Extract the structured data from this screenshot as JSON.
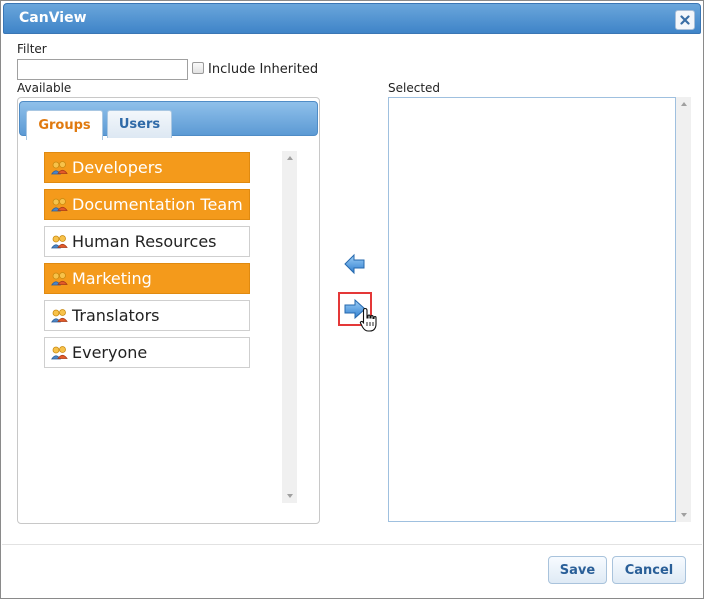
{
  "dialog": {
    "title": "CanView"
  },
  "filter": {
    "label": "Filter",
    "value": "",
    "include_inherited_label": "Include Inherited",
    "include_inherited_checked": false
  },
  "available": {
    "label": "Available",
    "tabs": [
      {
        "label": "Groups",
        "active": true
      },
      {
        "label": "Users",
        "active": false
      }
    ],
    "items": [
      {
        "label": "Developers",
        "selected": true
      },
      {
        "label": "Documentation Team",
        "selected": true
      },
      {
        "label": "Human Resources",
        "selected": false
      },
      {
        "label": "Marketing",
        "selected": true
      },
      {
        "label": "Translators",
        "selected": false
      },
      {
        "label": "Everyone",
        "selected": false
      }
    ]
  },
  "selected": {
    "label": "Selected"
  },
  "buttons": {
    "save": "Save",
    "cancel": "Cancel"
  },
  "colors": {
    "accent": "#3f84c8",
    "selection": "#f49a1b",
    "tab_active_text": "#e07a10"
  }
}
